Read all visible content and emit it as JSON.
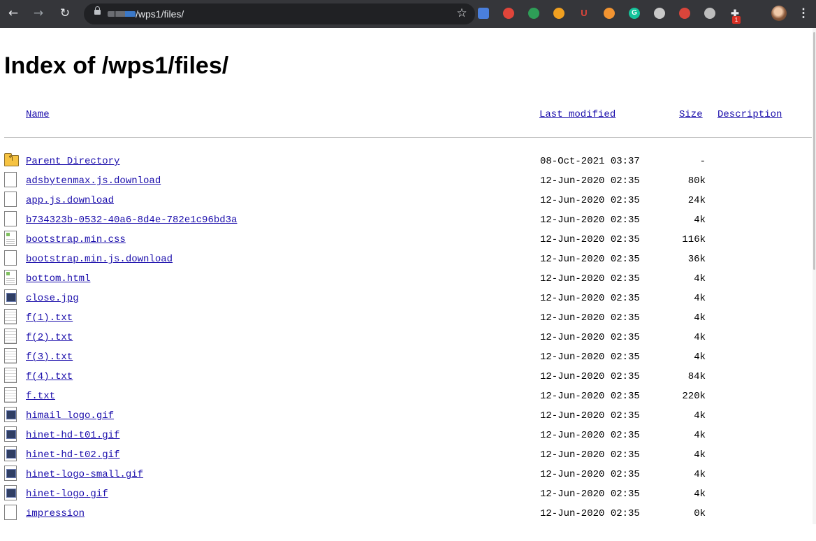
{
  "browser": {
    "url_path": "/wps1/files/",
    "nav": {
      "back_icon": "back-arrow-icon",
      "forward_icon": "forward-arrow-icon",
      "reload_icon": "reload-icon"
    },
    "extensions": [
      {
        "name": "translate-icon",
        "color": "#4a7fdc"
      },
      {
        "name": "grammar-icon",
        "color": "#e0453a"
      },
      {
        "name": "cloud-icon",
        "color": "#2e9e57"
      },
      {
        "name": "moon-icon",
        "color": "#f0a020"
      },
      {
        "name": "u-icon",
        "color": "#e0453a",
        "glyph": "U"
      },
      {
        "name": "search-lens-icon",
        "color": "#f29431"
      },
      {
        "name": "grammarly-icon",
        "color": "#15c39a",
        "glyph": "G"
      },
      {
        "name": "swirl-icon",
        "color": "#c9c9c9"
      },
      {
        "name": "shield-icon",
        "color": "#d9453b"
      },
      {
        "name": "dial-icon",
        "color": "#bdbdbd"
      },
      {
        "name": "puzzle-icon",
        "color": "#e8eaed"
      }
    ],
    "extension_badge": "1",
    "menu_glyph": "⋮"
  },
  "page": {
    "title": "Index of /wps1/files/",
    "columns": {
      "name": "Name",
      "modified": "Last modified",
      "size": "Size",
      "description": "Description"
    },
    "rows": [
      {
        "name": "Parent Directory",
        "modified": "08-Oct-2021 03:37",
        "size": "-",
        "icon": "parent-directory-icon",
        "kind": "dir"
      },
      {
        "name": "adsbytenmax.js.download",
        "modified": "12-Jun-2020 02:35",
        "size": "80k",
        "icon": "blank-file-icon",
        "kind": "blank"
      },
      {
        "name": "app.js.download",
        "modified": "12-Jun-2020 02:35",
        "size": "24k",
        "icon": "blank-file-icon",
        "kind": "blank"
      },
      {
        "name": "b734323b-0532-40a6-8d4e-782e1c96bd3a",
        "modified": "12-Jun-2020 02:35",
        "size": "4k",
        "icon": "blank-file-icon",
        "kind": "blank"
      },
      {
        "name": "bootstrap.min.css",
        "modified": "12-Jun-2020 02:35",
        "size": "116k",
        "icon": "layout-file-icon",
        "kind": "layout"
      },
      {
        "name": "bootstrap.min.js.download",
        "modified": "12-Jun-2020 02:35",
        "size": "36k",
        "icon": "blank-file-icon",
        "kind": "blank"
      },
      {
        "name": "bottom.html",
        "modified": "12-Jun-2020 02:35",
        "size": "4k",
        "icon": "layout-file-icon",
        "kind": "layout"
      },
      {
        "name": "close.jpg",
        "modified": "12-Jun-2020 02:35",
        "size": "4k",
        "icon": "image-file-icon",
        "kind": "image"
      },
      {
        "name": "f(1).txt",
        "modified": "12-Jun-2020 02:35",
        "size": "4k",
        "icon": "text-file-icon",
        "kind": "text"
      },
      {
        "name": "f(2).txt",
        "modified": "12-Jun-2020 02:35",
        "size": "4k",
        "icon": "text-file-icon",
        "kind": "text"
      },
      {
        "name": "f(3).txt",
        "modified": "12-Jun-2020 02:35",
        "size": "4k",
        "icon": "text-file-icon",
        "kind": "text"
      },
      {
        "name": "f(4).txt",
        "modified": "12-Jun-2020 02:35",
        "size": "84k",
        "icon": "text-file-icon",
        "kind": "text"
      },
      {
        "name": "f.txt",
        "modified": "12-Jun-2020 02:35",
        "size": "220k",
        "icon": "text-file-icon",
        "kind": "text"
      },
      {
        "name": "himail_logo.gif",
        "modified": "12-Jun-2020 02:35",
        "size": "4k",
        "icon": "image-file-icon",
        "kind": "image"
      },
      {
        "name": "hinet-hd-t01.gif",
        "modified": "12-Jun-2020 02:35",
        "size": "4k",
        "icon": "image-file-icon",
        "kind": "image"
      },
      {
        "name": "hinet-hd-t02.gif",
        "modified": "12-Jun-2020 02:35",
        "size": "4k",
        "icon": "image-file-icon",
        "kind": "image"
      },
      {
        "name": "hinet-logo-small.gif",
        "modified": "12-Jun-2020 02:35",
        "size": "4k",
        "icon": "image-file-icon",
        "kind": "image"
      },
      {
        "name": "hinet-logo.gif",
        "modified": "12-Jun-2020 02:35",
        "size": "4k",
        "icon": "image-file-icon",
        "kind": "image"
      },
      {
        "name": "impression",
        "modified": "12-Jun-2020 02:35",
        "size": "0k",
        "icon": "blank-file-icon",
        "kind": "blank"
      }
    ]
  }
}
